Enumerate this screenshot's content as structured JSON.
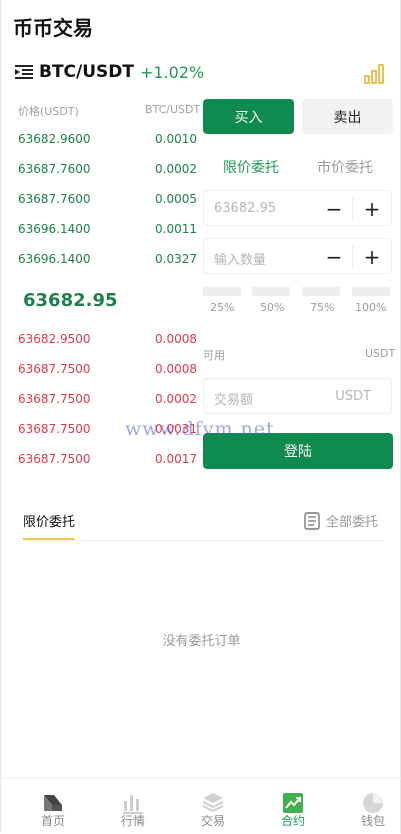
{
  "header": {
    "title": "币币交易"
  },
  "pair": {
    "name": "BTC/USDT",
    "change": "+1.02%"
  },
  "orderbook": {
    "price_header": "价格(USDT)",
    "qty_header": "BTC/USDT",
    "asks": [
      {
        "price": "63682.9600",
        "qty": "0.0010"
      },
      {
        "price": "63687.7600",
        "qty": "0.0002"
      },
      {
        "price": "63687.7600",
        "qty": "0.0005"
      },
      {
        "price": "63696.1400",
        "qty": "0.0011"
      },
      {
        "price": "63696.1400",
        "qty": "0.0327"
      }
    ],
    "last_price": "63682.95",
    "bids": [
      {
        "price": "63682.9500",
        "qty": "0.0008"
      },
      {
        "price": "63687.7500",
        "qty": "0.0008"
      },
      {
        "price": "63687.7500",
        "qty": "0.0002"
      },
      {
        "price": "63687.7500",
        "qty": "0.0031"
      },
      {
        "price": "63687.7500",
        "qty": "0.0017"
      }
    ]
  },
  "trade": {
    "buy_label": "买入",
    "sell_label": "卖出",
    "limit_label": "限价委托",
    "market_label": "市价委托",
    "price_value": "63682.95",
    "qty_placeholder": "输入数量",
    "minus": "−",
    "plus": "+",
    "percentages": [
      "25%",
      "50%",
      "75%",
      "100%"
    ],
    "available_label": "可用",
    "available_unit": "USDT",
    "amount_placeholder": "交易额",
    "amount_unit": "USDT",
    "login_label": "登陆"
  },
  "orders": {
    "tab_label": "限价委托",
    "all_label": "全部委托",
    "empty_text": "没有委托订单"
  },
  "watermark": "www.dfym.net",
  "nav": [
    {
      "label": "首页",
      "icon": "home-icon"
    },
    {
      "label": "行情",
      "icon": "market-icon"
    },
    {
      "label": "交易",
      "icon": "trade-icon"
    },
    {
      "label": "合约",
      "icon": "contract-icon"
    },
    {
      "label": "钱包",
      "icon": "wallet-icon"
    }
  ],
  "colors": {
    "accent_green": "#0f8a4f",
    "up_green": "#1e7f4c",
    "down_red": "#e0384b",
    "tab_underline": "#f2c94c"
  }
}
